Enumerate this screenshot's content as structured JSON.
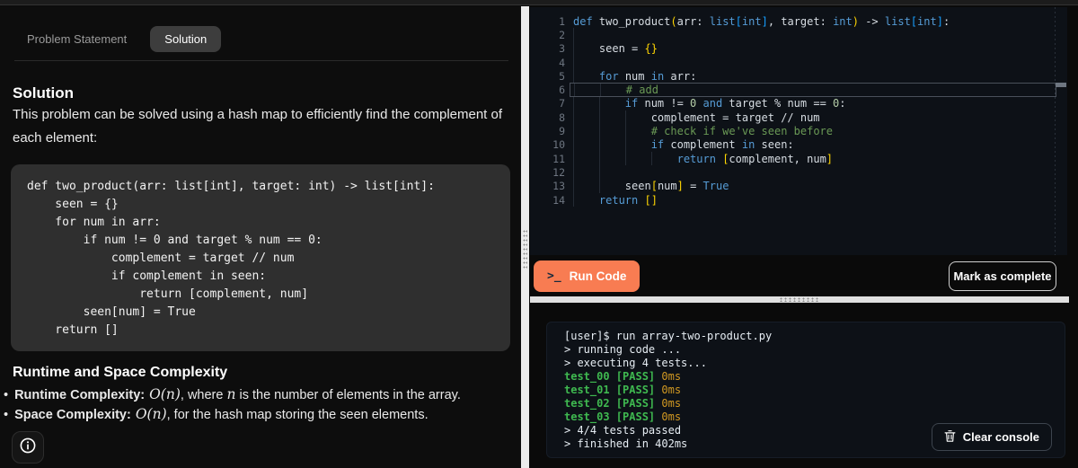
{
  "left_panel": {
    "tabs": [
      {
        "label": "Problem Statement",
        "active": false
      },
      {
        "label": "Solution",
        "active": true
      }
    ],
    "solution_heading": "Solution",
    "solution_text": "This problem can be solved using a hash map to efficiently find the complement of each element:",
    "code_block": "def two_product(arr: list[int], target: int) -> list[int]:\n    seen = {}\n    for num in arr:\n        if num != 0 and target % num == 0:\n            complement = target // num\n            if complement in seen:\n                return [complement, num]\n        seen[num] = True\n    return []",
    "complexity_heading": "Runtime and Space Complexity",
    "complexity_items": [
      {
        "label": "Runtime Complexity:",
        "math_a": "O(n)",
        "text_a": ", where ",
        "math_b": "n",
        "text_b": " is the number of elements in the array."
      },
      {
        "label": "Space Complexity:",
        "math_a": "O(n)",
        "text_a": ", for the hash map storing the seen elements.",
        "math_b": "",
        "text_b": ""
      }
    ],
    "info_icon": "info-circle-icon"
  },
  "editor": {
    "language": "python",
    "highlighted_line": 6,
    "lines": [
      {
        "n": 1,
        "tokens": [
          {
            "t": "def ",
            "c": "kw"
          },
          {
            "t": "two_product",
            "c": "pl"
          },
          {
            "t": "(",
            "c": "b1"
          },
          {
            "t": "arr: ",
            "c": "pl"
          },
          {
            "t": "list",
            "c": "kw"
          },
          {
            "t": "[",
            "c": "b2"
          },
          {
            "t": "int",
            "c": "kw"
          },
          {
            "t": "]",
            "c": "b2"
          },
          {
            "t": ", target: ",
            "c": "pl"
          },
          {
            "t": "int",
            "c": "kw"
          },
          {
            "t": ")",
            "c": "b1"
          },
          {
            "t": " -> ",
            "c": "pl"
          },
          {
            "t": "list",
            "c": "kw"
          },
          {
            "t": "[",
            "c": "b2"
          },
          {
            "t": "int",
            "c": "kw"
          },
          {
            "t": "]",
            "c": "b2"
          },
          {
            "t": ":",
            "c": "pl"
          }
        ]
      },
      {
        "n": 2,
        "tokens": []
      },
      {
        "n": 3,
        "tokens": [
          {
            "t": "    seen = ",
            "c": "pl"
          },
          {
            "t": "{}",
            "c": "b1"
          }
        ]
      },
      {
        "n": 4,
        "tokens": []
      },
      {
        "n": 5,
        "tokens": [
          {
            "t": "    ",
            "c": "pl"
          },
          {
            "t": "for",
            "c": "kw"
          },
          {
            "t": " num ",
            "c": "pl"
          },
          {
            "t": "in",
            "c": "kw"
          },
          {
            "t": " arr:",
            "c": "pl"
          }
        ]
      },
      {
        "n": 6,
        "tokens": [
          {
            "t": "        ",
            "c": "pl"
          },
          {
            "t": "# add",
            "c": "cm"
          }
        ]
      },
      {
        "n": 7,
        "tokens": [
          {
            "t": "        ",
            "c": "pl"
          },
          {
            "t": "if",
            "c": "kw"
          },
          {
            "t": " num != ",
            "c": "pl"
          },
          {
            "t": "0",
            "c": "num"
          },
          {
            "t": " ",
            "c": "pl"
          },
          {
            "t": "and",
            "c": "kw"
          },
          {
            "t": " target % num == ",
            "c": "pl"
          },
          {
            "t": "0",
            "c": "num"
          },
          {
            "t": ":",
            "c": "pl"
          }
        ]
      },
      {
        "n": 8,
        "tokens": [
          {
            "t": "            complement = target // num",
            "c": "pl"
          }
        ]
      },
      {
        "n": 9,
        "tokens": [
          {
            "t": "            ",
            "c": "pl"
          },
          {
            "t": "# check if we've seen before",
            "c": "cm"
          }
        ]
      },
      {
        "n": 10,
        "tokens": [
          {
            "t": "            ",
            "c": "pl"
          },
          {
            "t": "if",
            "c": "kw"
          },
          {
            "t": " complement ",
            "c": "pl"
          },
          {
            "t": "in",
            "c": "kw"
          },
          {
            "t": " seen:",
            "c": "pl"
          }
        ]
      },
      {
        "n": 11,
        "tokens": [
          {
            "t": "                ",
            "c": "pl"
          },
          {
            "t": "return",
            "c": "kw"
          },
          {
            "t": " ",
            "c": "pl"
          },
          {
            "t": "[",
            "c": "b1"
          },
          {
            "t": "complement, num",
            "c": "pl"
          },
          {
            "t": "]",
            "c": "b1"
          }
        ]
      },
      {
        "n": 12,
        "tokens": []
      },
      {
        "n": 13,
        "tokens": [
          {
            "t": "        seen",
            "c": "pl"
          },
          {
            "t": "[",
            "c": "b1"
          },
          {
            "t": "num",
            "c": "pl"
          },
          {
            "t": "]",
            "c": "b1"
          },
          {
            "t": " = ",
            "c": "pl"
          },
          {
            "t": "True",
            "c": "kw"
          }
        ]
      },
      {
        "n": 14,
        "tokens": [
          {
            "t": "    ",
            "c": "pl"
          },
          {
            "t": "return",
            "c": "kw"
          },
          {
            "t": " ",
            "c": "pl"
          },
          {
            "t": "[]",
            "c": "b1"
          }
        ]
      }
    ]
  },
  "actions": {
    "run_label": "Run Code",
    "run_icon_glyph": ">_",
    "mark_label": "Mark as complete"
  },
  "console": {
    "lines": [
      {
        "tokens": [
          {
            "t": "[user]$ run array-two-product.py",
            "c": "pl"
          }
        ]
      },
      {
        "tokens": [
          {
            "t": "> running code ...",
            "c": "pl"
          }
        ]
      },
      {
        "tokens": [
          {
            "t": "> executing 4 tests...",
            "c": "pl"
          }
        ]
      },
      {
        "tokens": [
          {
            "t": "test_00 [PASS]",
            "c": "ok"
          },
          {
            "t": " 0ms",
            "c": "ms"
          }
        ]
      },
      {
        "tokens": [
          {
            "t": "test_01 [PASS]",
            "c": "ok"
          },
          {
            "t": " 0ms",
            "c": "ms"
          }
        ]
      },
      {
        "tokens": [
          {
            "t": "test_02 [PASS]",
            "c": "ok"
          },
          {
            "t": " 0ms",
            "c": "ms"
          }
        ]
      },
      {
        "tokens": [
          {
            "t": "test_03 [PASS]",
            "c": "ok"
          },
          {
            "t": " 0ms",
            "c": "ms"
          }
        ]
      },
      {
        "tokens": [
          {
            "t": "> 4/4 tests passed",
            "c": "pl"
          }
        ]
      },
      {
        "tokens": [
          {
            "t": "> finished in 402ms",
            "c": "pl"
          }
        ]
      }
    ],
    "clear_label": "Clear console"
  },
  "colors": {
    "accent_orange": "#f87c52",
    "pass_green": "#3fb950",
    "time_yellow": "#d29922",
    "keyword_blue": "#569cd6",
    "comment_green": "#6a9955",
    "bracket_gold": "#ffd602",
    "bracket_blue": "#179fff",
    "editor_bg": "#0d1117"
  }
}
